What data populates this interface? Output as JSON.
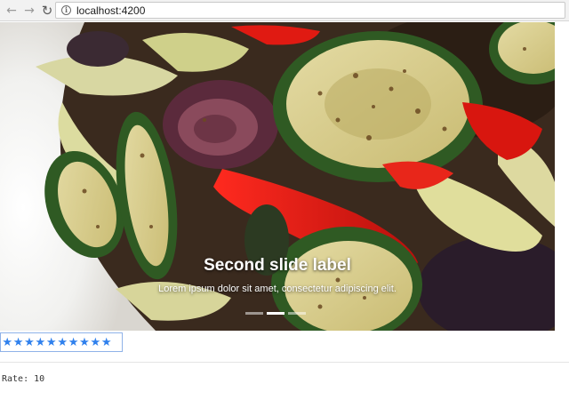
{
  "browser": {
    "url": "localhost:4200",
    "back_glyph": "←",
    "forward_glyph": "→",
    "reload_glyph": "↻",
    "info_glyph": "i"
  },
  "carousel": {
    "caption_title": "Second slide label",
    "caption_text": "Lorem ipsum dolor sit amet, consectetur adipiscing elit.",
    "slide_count": 3,
    "active_slide": 2
  },
  "rating": {
    "value": 10,
    "max": 10,
    "star_glyph": "★",
    "color": "#2f80ed"
  },
  "readout": {
    "label": "Rate:",
    "value": "10"
  }
}
